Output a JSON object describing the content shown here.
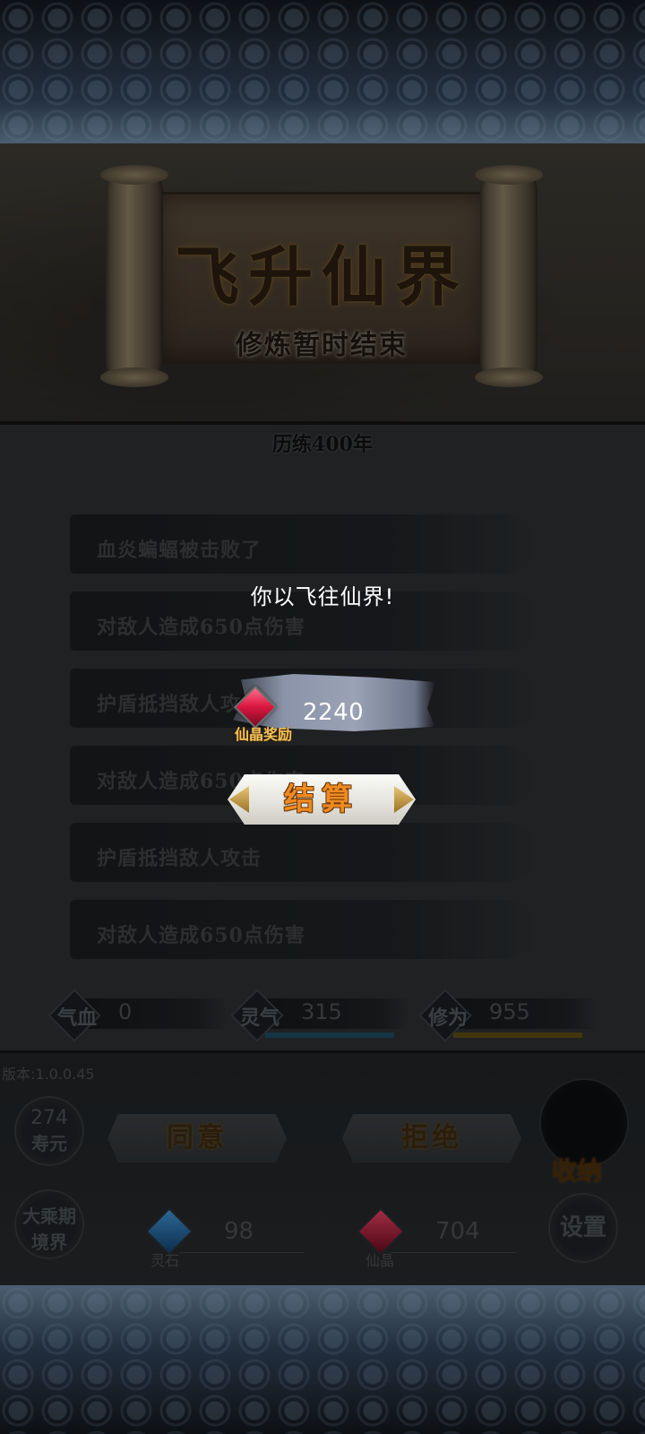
{
  "header": {
    "title": "飞升仙界",
    "subtitle": "修炼暂时结束"
  },
  "training_years": "历练400年",
  "battle_log": [
    "血炎蝙蝠被击败了",
    "对敌人造成650点伤害",
    "护盾抵挡敌人攻击",
    "对敌人造成650点伤害",
    "护盾抵挡敌人攻击",
    "对敌人造成650点伤害"
  ],
  "stats": [
    {
      "label": "气血",
      "value": "0",
      "fill": 0.0,
      "color": "#1c1f22"
    },
    {
      "label": "灵气",
      "value": "315",
      "fill": 0.9,
      "color": "#1f4a5c"
    },
    {
      "label": "修为",
      "value": "955",
      "fill": 0.9,
      "color": "#5a4a12"
    }
  ],
  "version": "版本:1.0.0.45",
  "lifespan": {
    "value": "274",
    "label": "寿元"
  },
  "realm": {
    "value": "大乘期",
    "label": "境界"
  },
  "choices": {
    "agree": "同意",
    "reject": "拒绝"
  },
  "store_label": "收纳",
  "settings_label": "设置",
  "currencies": [
    {
      "label": "灵石",
      "value": "98",
      "icon_color": "#1f6fb0"
    },
    {
      "label": "仙晶",
      "value": "704",
      "icon_color": "#c41535"
    }
  ],
  "popup": {
    "message": "你以飞往仙界!",
    "reward_label": "仙晶奖励",
    "reward_value": "2240",
    "settle_button": "结算"
  },
  "colors": {
    "accent_orange": "#ef8a22",
    "reward_gold": "#f5c458",
    "crystal_red": "#d8163f"
  }
}
